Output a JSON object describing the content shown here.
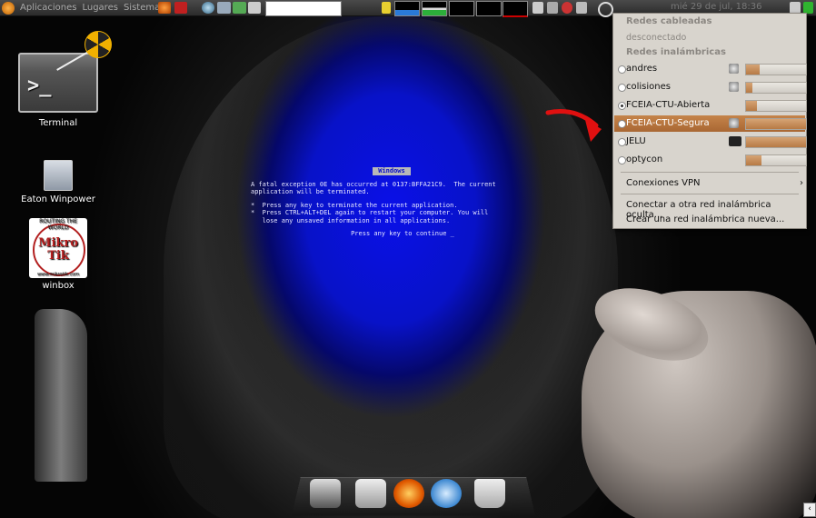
{
  "panel": {
    "menus": [
      "Aplicaciones",
      "Lugares",
      "Sistema"
    ],
    "clock": "mié 29 de jul, 18:36"
  },
  "desktop": {
    "icons": [
      {
        "label": "Terminal",
        "icon": "terminal-icon"
      },
      {
        "label": "Eaton Winpower",
        "icon": "eaton-icon"
      },
      {
        "label": "winbox",
        "icon": "mikrotik-icon"
      }
    ],
    "mikrotik_logo": {
      "top": "ROUTING THE WORLD",
      "line1": "Mikro",
      "line2": "Tik",
      "bottom": "www.mikrotik.com"
    }
  },
  "bsod": {
    "header": "Windows",
    "line1": "A fatal exception 0E has occurred at 0137:BFFA21C9.  The current\napplication will be terminated.",
    "line2": "*  Press any key to terminate the current application.\n*  Press CTRL+ALT+DEL again to restart your computer. You will\n   lose any unsaved information in all applications.",
    "line3": "Press any key to continue _"
  },
  "network_menu": {
    "wired_header": "Redes cableadas",
    "wired_status": "desconectado",
    "wireless_header": "Redes inalámbricas",
    "networks": [
      {
        "name": "andres",
        "selected": false,
        "active": false,
        "signal": 0.22,
        "secured": true
      },
      {
        "name": "colisiones",
        "selected": false,
        "active": false,
        "signal": 0.1,
        "secured": true
      },
      {
        "name": "FCEIA-CTU-Abierta",
        "selected": true,
        "active": false,
        "signal": 0.18,
        "secured": false
      },
      {
        "name": "FCEIA-CTU-Segura",
        "selected": false,
        "active": true,
        "signal": 1.0,
        "secured": true
      },
      {
        "name": "JELU",
        "selected": false,
        "active": false,
        "signal": 1.0,
        "secured": true
      },
      {
        "name": "optycon",
        "selected": false,
        "active": false,
        "signal": 0.25,
        "secured": false
      }
    ],
    "vpn": "Conexiones VPN",
    "connect_hidden": "Conectar a otra red inalámbrica oculta...",
    "create_new": "Crear una red inalámbrica nueva..."
  },
  "colors": {
    "accent": "#b77a45",
    "menu_bg": "#d8d4cd",
    "bsod_blue": "#0a10e8",
    "arrow_red": "#e01010"
  }
}
